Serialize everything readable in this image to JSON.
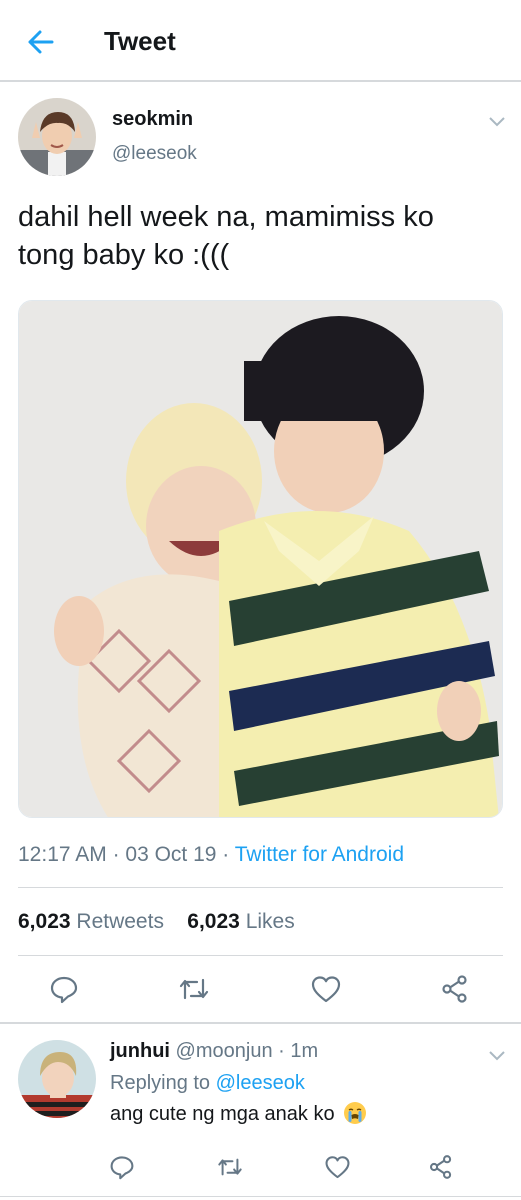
{
  "header": {
    "title": "Tweet"
  },
  "tweet": {
    "name": "seokmin",
    "handle": "@leeseok",
    "text": "dahil hell week na, mamimiss ko tong baby ko :(((",
    "time": "12:17 AM",
    "date": "03 Oct 19",
    "source": "Twitter for Android",
    "separator": " · ",
    "retweets_count": "6,023",
    "retweets_label": "Retweets",
    "likes_count": "6,023",
    "likes_label": "Likes"
  },
  "reply": {
    "name": "junhui",
    "handle": "@moonjun",
    "age": "1m",
    "replying_prefix": "Replying to",
    "replying_handle": "@leeseok",
    "text": "ang cute ng mga anak ko"
  },
  "icons": {
    "back": "arrow-left-icon",
    "caret": "chevron-down-icon",
    "reply": "speech-bubble-icon",
    "retweet": "retweet-icon",
    "like": "heart-icon",
    "share": "share-icon",
    "emoji": "crying-face-emoji"
  },
  "colors": {
    "accent": "#1da1f2",
    "muted": "#657786",
    "text": "#14171a",
    "divider": "#d6d9dc"
  }
}
